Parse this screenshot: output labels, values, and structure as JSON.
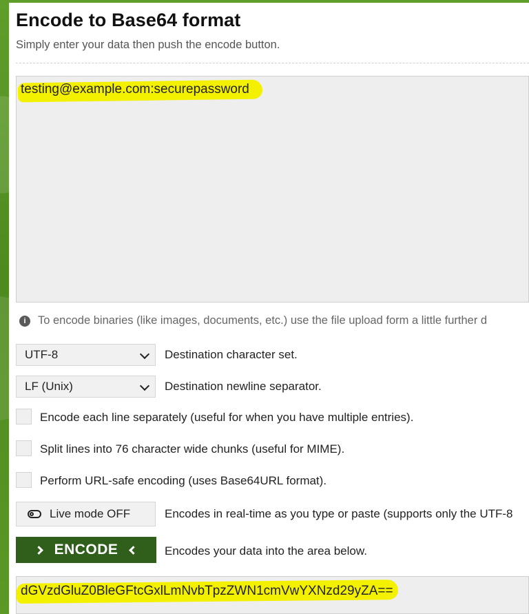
{
  "header": {
    "title": "Encode to Base64 format",
    "subtitle": "Simply enter your data then push the encode button."
  },
  "input": {
    "value": "testing@example.com:securepassword"
  },
  "info": {
    "icon": "info-icon",
    "text": "To encode binaries (like images, documents, etc.) use the file upload form a little further d"
  },
  "options": {
    "charset": {
      "selected": "UTF-8",
      "label": "Destination character set."
    },
    "newline": {
      "selected": "LF (Unix)",
      "label": "Destination newline separator."
    },
    "checkboxes": [
      {
        "label": "Encode each line separately (useful for when you have multiple entries)."
      },
      {
        "label": "Split lines into 76 character wide chunks (useful for MIME)."
      },
      {
        "label": "Perform URL-safe encoding (uses Base64URL format)."
      }
    ],
    "live_mode": {
      "button_label": "Live mode OFF",
      "description": "Encodes in real-time as you type or paste (supports only the UTF-8"
    },
    "encode": {
      "button_label": "ENCODE",
      "description": "Encodes your data into the area below."
    }
  },
  "output": {
    "value": "dGVzdGluZ0BleGFtcGxlLmNvbTpzZWN1cmVwYXNzd29yZA=="
  },
  "colors": {
    "accent_green": "#2f5f1a",
    "highlight_yellow": "#f4f100",
    "background_green": "#4f8a1f"
  }
}
